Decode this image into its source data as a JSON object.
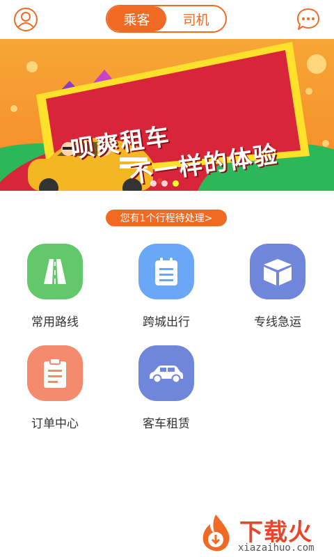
{
  "header": {
    "tabs": [
      {
        "label": "乘客",
        "active": true
      },
      {
        "label": "司机",
        "active": false
      }
    ],
    "profile_icon": "user-circle-icon",
    "message_icon": "chat-bubble-icon",
    "accent": "#f06a24"
  },
  "banner": {
    "line1": "呗爽租车",
    "line2": "不一样的体验",
    "slides": 3,
    "active_slide": 3
  },
  "pending": {
    "label": "您有1个行程待处理>"
  },
  "grid": [
    {
      "label": "常用路线",
      "icon": "road-icon",
      "color": "#63c86b"
    },
    {
      "label": "跨城出行",
      "icon": "notepad-icon",
      "color": "#6aa8f7"
    },
    {
      "label": "专线急运",
      "icon": "box-icon",
      "color": "#6f86db"
    },
    {
      "label": "订单中心",
      "icon": "clipboard-icon",
      "color": "#f68a6c"
    },
    {
      "label": "客车租赁",
      "icon": "car-icon",
      "color": "#6f86db"
    }
  ],
  "watermark": {
    "brand": "下载火",
    "url": "xiazaihuo.com"
  }
}
